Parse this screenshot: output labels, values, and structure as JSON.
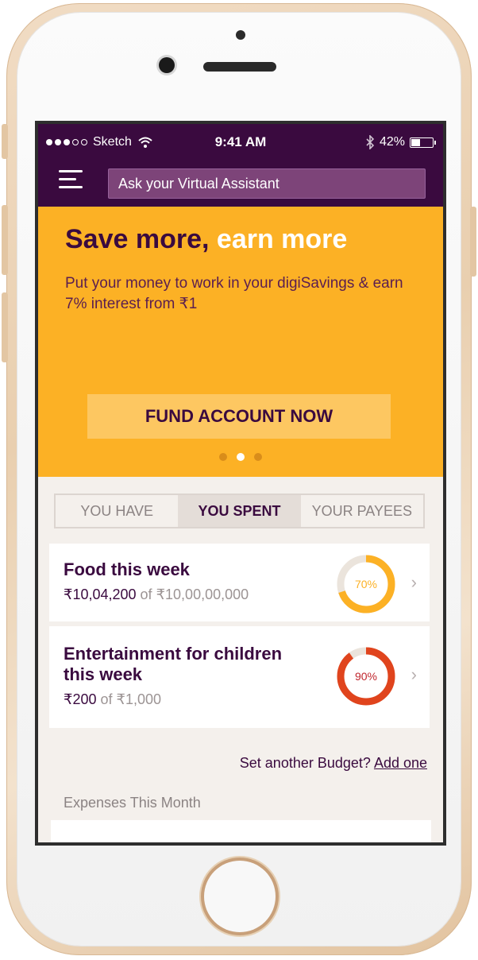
{
  "status_bar": {
    "carrier": "Sketch",
    "time": "9:41 AM",
    "battery_text": "42%",
    "battery_level": 0.42
  },
  "app_bar": {
    "menu_icon": "hamburger-menu-icon",
    "assistant_placeholder": "Ask your Virtual Assistant"
  },
  "banner": {
    "headline_main": "Save more,",
    "headline_accent": "earn more",
    "subtitle": "Put your money to work in your digiSavings & earn 7% interest from ₹1",
    "cta_label": "FUND ACCOUNT NOW",
    "pager_count": 3,
    "pager_active_index": 1,
    "background_color": "#fcb125"
  },
  "tabs": [
    {
      "label": "YOU HAVE",
      "active": false
    },
    {
      "label": "YOU SPENT",
      "active": true
    },
    {
      "label": "YOUR PAYEES",
      "active": false
    }
  ],
  "budgets": [
    {
      "title_line1": "Food this week",
      "title_line2": "",
      "spent": "₹10,04,200",
      "of_label": "of",
      "limit": "₹10,00,00,000",
      "percent_label": "70%",
      "percent": 70,
      "color": "#fcb125"
    },
    {
      "title_line1": "Entertainment for children",
      "title_line2": "this week",
      "spent": "₹200",
      "of_label": "of",
      "limit": "₹1,000",
      "percent_label": "90%",
      "percent": 90,
      "color": "#e0441d"
    }
  ],
  "set_budget": {
    "prompt": "Set another Budget?",
    "link": "Add one"
  },
  "expenses_label": "Expenses This Month",
  "colors": {
    "brand_purple": "#3a0a3f",
    "accent_orange": "#fcb125",
    "alert_red": "#e0441d"
  }
}
